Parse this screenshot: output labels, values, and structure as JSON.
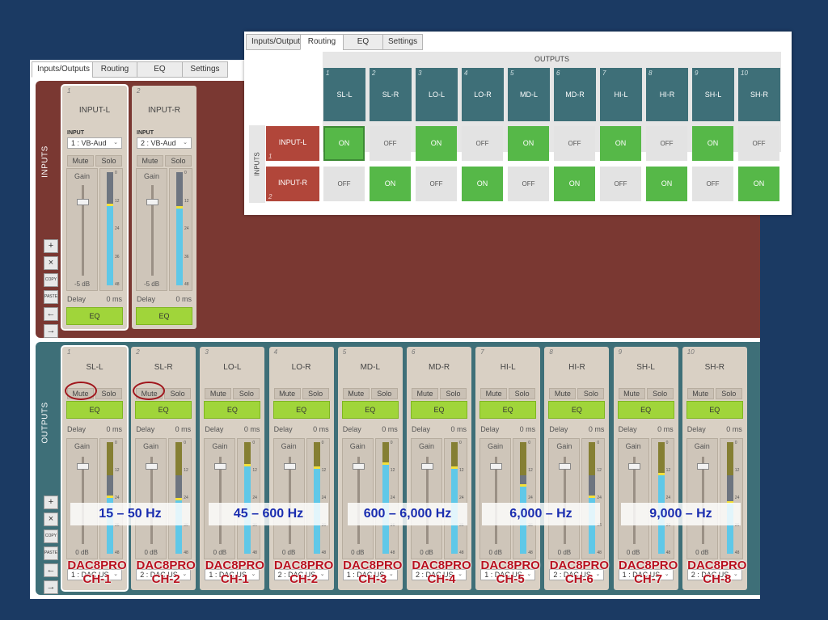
{
  "tabs": [
    "Inputs/Outputs",
    "Routing",
    "EQ",
    "Settings"
  ],
  "panels": {
    "inputs_label": "INPUTS",
    "outputs_label": "OUTPUTS"
  },
  "tools": [
    "+",
    "×",
    "COPY",
    "PASTE",
    "←",
    "→"
  ],
  "inputs": [
    {
      "num": "1",
      "name": "INPUT-L",
      "label": "INPUT",
      "device": "1 : VB-Aud",
      "mute": "Mute",
      "solo": "Solo",
      "gain": "Gain",
      "gain_value": "-5 dB",
      "delay": "Delay",
      "delay_value": "0 ms",
      "eq": "EQ",
      "level": 0.7,
      "fader": 0.85
    },
    {
      "num": "2",
      "name": "INPUT-R",
      "label": "INPUT",
      "device": "2 : VB-Aud",
      "mute": "Mute",
      "solo": "Solo",
      "gain": "Gain",
      "gain_value": "-5 dB",
      "delay": "Delay",
      "delay_value": "0 ms",
      "eq": "EQ",
      "level": 0.68,
      "fader": 0.85
    }
  ],
  "meter_scale": [
    "0",
    "12",
    "24",
    "36",
    "48"
  ],
  "outputs": [
    {
      "num": "1",
      "name": "SL-L",
      "mute": "Mute",
      "solo": "Solo",
      "eq": "EQ",
      "delay": "Delay",
      "delay_value": "0 ms",
      "gain": "Gain",
      "gain_value": "0 dB",
      "device": "1 : DAC US",
      "level": 0.5
    },
    {
      "num": "2",
      "name": "SL-R",
      "mute": "Mute",
      "solo": "Solo",
      "eq": "EQ",
      "delay": "Delay",
      "delay_value": "0 ms",
      "gain": "Gain",
      "gain_value": "0 dB",
      "device": "2 : DAC US",
      "level": 0.48
    },
    {
      "num": "3",
      "name": "LO-L",
      "mute": "Mute",
      "solo": "Solo",
      "eq": "EQ",
      "delay": "Delay",
      "delay_value": "0 ms",
      "gain": "Gain",
      "gain_value": "0 dB",
      "device": "1 : DAC US",
      "level": 0.78
    },
    {
      "num": "4",
      "name": "LO-R",
      "mute": "Mute",
      "solo": "Solo",
      "eq": "EQ",
      "delay": "Delay",
      "delay_value": "0 ms",
      "gain": "Gain",
      "gain_value": "0 dB",
      "device": "2 : DAC US",
      "level": 0.76
    },
    {
      "num": "5",
      "name": "MD-L",
      "mute": "Mute",
      "solo": "Solo",
      "eq": "EQ",
      "delay": "Delay",
      "delay_value": "0 ms",
      "gain": "Gain",
      "gain_value": "0 dB",
      "device": "1 : DAC US",
      "level": 0.8
    },
    {
      "num": "6",
      "name": "MD-R",
      "mute": "Mute",
      "solo": "Solo",
      "eq": "EQ",
      "delay": "Delay",
      "delay_value": "0 ms",
      "gain": "Gain",
      "gain_value": "0 dB",
      "device": "2 : DAC US",
      "level": 0.76
    },
    {
      "num": "7",
      "name": "HI-L",
      "mute": "Mute",
      "solo": "Solo",
      "eq": "EQ",
      "delay": "Delay",
      "delay_value": "0 ms",
      "gain": "Gain",
      "gain_value": "0 dB",
      "device": "1 : DAC US",
      "level": 0.6
    },
    {
      "num": "8",
      "name": "HI-R",
      "mute": "Mute",
      "solo": "Solo",
      "eq": "EQ",
      "delay": "Delay",
      "delay_value": "0 ms",
      "gain": "Gain",
      "gain_value": "0 dB",
      "device": "2 : DAC US",
      "level": 0.5
    },
    {
      "num": "9",
      "name": "SH-L",
      "mute": "Mute",
      "solo": "Solo",
      "eq": "EQ",
      "delay": "Delay",
      "delay_value": "0 ms",
      "gain": "Gain",
      "gain_value": "0 dB",
      "device": "1 : DAC US",
      "level": 0.7
    },
    {
      "num": "10",
      "name": "SH-R",
      "mute": "Mute",
      "solo": "Solo",
      "eq": "EQ",
      "delay": "Delay",
      "delay_value": "0 ms",
      "gain": "Gain",
      "gain_value": "0 dB",
      "device": "2 : DAC US",
      "level": 0.45
    }
  ],
  "bands": [
    "15 – 50 Hz",
    "45 – 600 Hz",
    "600 – 6,000 Hz",
    "6,000 –  Hz",
    "9,000 –   Hz"
  ],
  "dac_labels": [
    {
      "top": "DAC8PRO",
      "bottom": "CH-1"
    },
    {
      "top": "DAC8PRO",
      "bottom": "CH-2"
    },
    {
      "top": "DAC8PRO",
      "bottom": "CH-1"
    },
    {
      "top": "DAC8PRO",
      "bottom": "CH-2"
    },
    {
      "top": "DAC8PRO",
      "bottom": "CH-3"
    },
    {
      "top": "DAC8PRO",
      "bottom": "CH-4"
    },
    {
      "top": "DAC8PRO",
      "bottom": "CH-5"
    },
    {
      "top": "DAC8PRO",
      "bottom": "CH-6"
    },
    {
      "top": "DAC8PRO",
      "bottom": "CH-7"
    },
    {
      "top": "DAC8PRO",
      "bottom": "CH-8"
    }
  ],
  "routing": {
    "tabs": [
      "Inputs/Outputs",
      "Routing",
      "EQ",
      "Settings"
    ],
    "outputs_title": "OUTPUTS",
    "inputs_title": "INPUTS",
    "outputs": [
      {
        "num": "1",
        "name": "SL-L"
      },
      {
        "num": "2",
        "name": "SL-R"
      },
      {
        "num": "3",
        "name": "LO-L"
      },
      {
        "num": "4",
        "name": "LO-R"
      },
      {
        "num": "5",
        "name": "MD-L"
      },
      {
        "num": "6",
        "name": "MD-R"
      },
      {
        "num": "7",
        "name": "HI-L"
      },
      {
        "num": "8",
        "name": "HI-R"
      },
      {
        "num": "9",
        "name": "SH-L"
      },
      {
        "num": "10",
        "name": "SH-R"
      }
    ],
    "inputs": [
      {
        "num": "1",
        "name": "INPUT-L",
        "cells": [
          "ON",
          "OFF",
          "ON",
          "OFF",
          "ON",
          "OFF",
          "ON",
          "OFF",
          "ON",
          "OFF"
        ]
      },
      {
        "num": "2",
        "name": "INPUT-R",
        "cells": [
          "OFF",
          "ON",
          "OFF",
          "ON",
          "OFF",
          "ON",
          "OFF",
          "ON",
          "OFF",
          "ON"
        ]
      }
    ]
  }
}
